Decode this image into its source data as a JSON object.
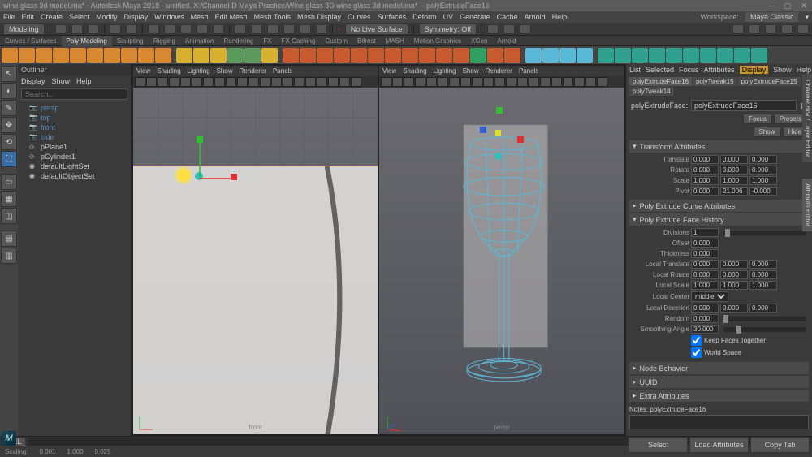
{
  "titlebar": {
    "text": "wine glass 3d model.ma* - Autodesk Maya 2018 - untitled.  X:/Channel D Maya Practice/Wine glass 3D wine glass 3d model.ma* -- polyExtrudeFace16"
  },
  "menubar": {
    "items": [
      "File",
      "Edit",
      "Create",
      "Select",
      "Modify",
      "Display",
      "Windows",
      "Mesh",
      "Edit Mesh",
      "Mesh Tools",
      "Mesh Display",
      "Curves",
      "Surfaces",
      "Deform",
      "UV",
      "Generate",
      "Cache",
      "Arnold",
      "Help"
    ],
    "workspace_label": "Workspace:",
    "workspace_value": "Maya Classic"
  },
  "statusstrip": {
    "menuset": "Modeling",
    "nolive": "No Live Surface",
    "symmetry": "Symmetry: Off"
  },
  "shelftabs": [
    "Curves / Surfaces",
    "Poly Modeling",
    "Sculpting",
    "Rigging",
    "Animation",
    "Rendering",
    "FX",
    "FX Caching",
    "Custom",
    "Bifrost",
    "MASH",
    "Motion Graphics",
    "XGen",
    "Arnold"
  ],
  "shelftabs_active": 1,
  "outliner": {
    "title": "Outliner",
    "menu": [
      "Display",
      "Show",
      "Help"
    ],
    "search_placeholder": "Search...",
    "nodes": [
      "persp",
      "top",
      "front",
      "side",
      "pPlane1",
      "pCylinder1",
      "defaultLightSet",
      "defaultObjectSet"
    ]
  },
  "viewport": {
    "menu": [
      "View",
      "Shading",
      "Lighting",
      "Show",
      "Renderer",
      "Panels"
    ],
    "left_label": "front",
    "right_label": "persp"
  },
  "attr": {
    "topmenu": [
      "List",
      "Selected",
      "Focus",
      "Attributes",
      "Display",
      "Show",
      "Help"
    ],
    "tabs": [
      "polyExtrudeFace16",
      "polyTweak15",
      "polyExtrudeFace15",
      "polyTweak14"
    ],
    "node_label": "polyExtrudeFace:",
    "node_value": "polyExtrudeFace16",
    "sidebtns": [
      "Focus",
      "Presets",
      "Show",
      "Hide"
    ],
    "sections": {
      "transform": {
        "title": "Transform Attributes",
        "translate": [
          "0.000",
          "0.000",
          "0.000"
        ],
        "rotate": [
          "0.000",
          "0.000",
          "0.000"
        ],
        "scale": [
          "1.000",
          "1.000",
          "1.000"
        ],
        "pivot": [
          "0.000",
          "21.006",
          "-0.000"
        ]
      },
      "extrudecurve": {
        "title": "Poly Extrude Curve Attributes"
      },
      "history": {
        "title": "Poly Extrude Face History",
        "divisions": "1",
        "offset": "0.000",
        "thickness": "0.000",
        "local_translate": [
          "0.000",
          "0.000",
          "0.000"
        ],
        "local_rotate": [
          "0.000",
          "0.000",
          "0.000"
        ],
        "local_scale": [
          "1.000",
          "1.000",
          "1.000"
        ],
        "local_center": "middle",
        "local_direction": [
          "0.000",
          "0.000",
          "0.000"
        ],
        "random": "0.000",
        "smoothing_angle": "30.000",
        "keep_faces": true,
        "world_space": true
      },
      "nodebehavior": {
        "title": "Node Behavior"
      },
      "uuid": {
        "title": "UUID"
      },
      "extra": {
        "title": "Extra Attributes"
      }
    },
    "labels": {
      "translate": "Translate",
      "rotate": "Rotate",
      "scale": "Scale",
      "pivot": "Pivot",
      "divisions": "Divisions",
      "offset": "Offset",
      "thickness": "Thickness",
      "local_translate": "Local Translate",
      "local_rotate": "Local Rotate",
      "local_scale": "Local Scale",
      "local_center": "Local Center",
      "local_direction": "Local Direction",
      "random": "Random",
      "smoothing_angle": "Smoothing Angle",
      "keep_faces": "Keep Faces Together",
      "world_space": "World Space"
    },
    "notes_label": "Notes: polyExtrudeFace16",
    "bottombtns": [
      "Select",
      "Load Attributes",
      "Copy Tab"
    ]
  },
  "sidetab1": "Channel Box / Layer Editor",
  "sidetab2": "Attribute Editor",
  "cmdline": {
    "tag": "MEL"
  },
  "bottom": {
    "scaling": "Scaling:",
    "vals": [
      "0.001",
      "1.000",
      "0.025"
    ]
  }
}
